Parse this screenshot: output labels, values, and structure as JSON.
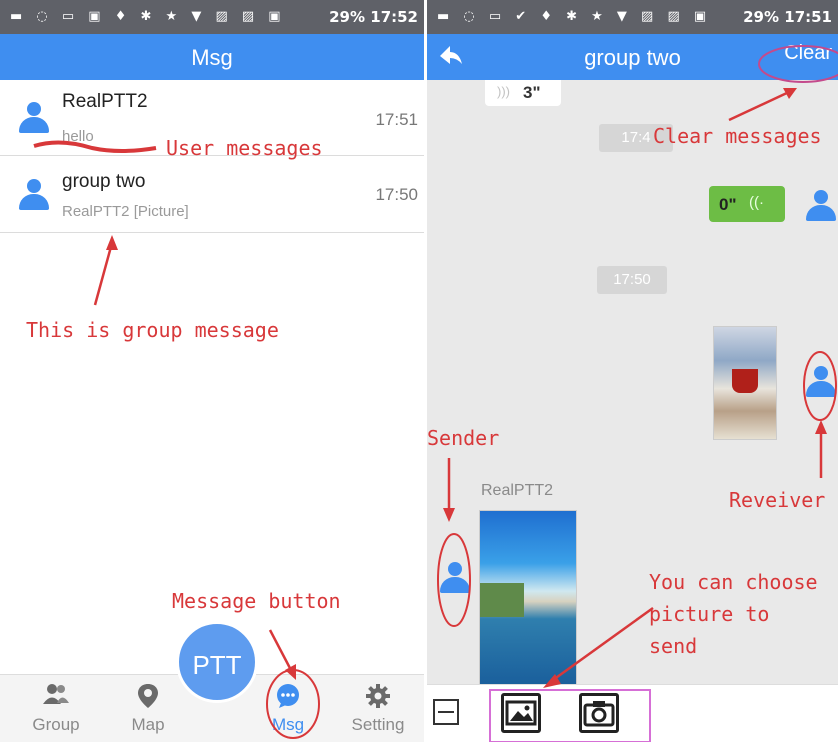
{
  "left": {
    "status": {
      "icons": "▬ ◌ ▭ ▣ ♦ ✱ ★ ▼ ▨ ▨ ▣",
      "battery_time": "29% 17:52"
    },
    "title": "Msg",
    "messages": [
      {
        "name": "RealPTT2",
        "preview": "hello",
        "time": "17:51"
      },
      {
        "name": "group two",
        "preview": "RealPTT2 [Picture]",
        "time": "17:50"
      }
    ],
    "ptt_label": "PTT",
    "nav": [
      {
        "label": "Group",
        "icon": "group-icon"
      },
      {
        "label": "Map",
        "icon": "map-pin-icon"
      },
      {
        "label": "Msg",
        "icon": "message-icon"
      },
      {
        "label": "Setting",
        "icon": "gear-icon"
      }
    ],
    "annotations": {
      "user_messages": "User messages",
      "group_message": "This is group message",
      "message_button": "Message button"
    }
  },
  "right": {
    "status": {
      "icons": "▬ ◌ ▭ ✔ ♦ ✱ ★ ▼ ▨ ▨ ▣",
      "battery_time": "29% 17:51"
    },
    "title": "group two",
    "clear_label": "Clear",
    "voice_top": "3\"",
    "time_1": "17:4",
    "voice_sent": "0\"",
    "time_2": "17:50",
    "sender_name": "RealPTT2",
    "annotations": {
      "clear_messages": "Clear messages",
      "sender": "Sender",
      "receiver": "Reveiver",
      "choose_picture": "You can choose\npicture to\nsend"
    }
  },
  "colors": {
    "accent": "#3f8ef0",
    "annotation": "#d8383a",
    "sent_bubble": "#6dbd45"
  }
}
